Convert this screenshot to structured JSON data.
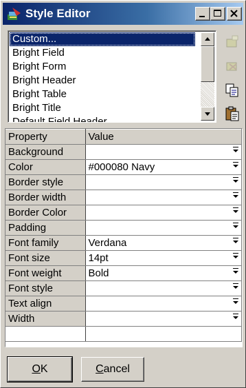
{
  "window": {
    "title": "Style Editor",
    "caption_buttons": [
      "minimize",
      "maximize",
      "close"
    ]
  },
  "style_list": {
    "items": [
      "Custom...",
      "Bright Field",
      "Bright Form",
      "Bright Header",
      "Bright Table",
      "Bright Title",
      "Default Field Header"
    ],
    "selected_index": 0
  },
  "side_tools": [
    {
      "name": "new-style-icon",
      "enabled": false
    },
    {
      "name": "delete-style-icon",
      "enabled": false
    },
    {
      "name": "copy-icon",
      "enabled": true
    },
    {
      "name": "paste-icon",
      "enabled": true
    }
  ],
  "grid": {
    "header_property": "Property",
    "header_value": "Value",
    "rows": [
      {
        "property": "Background",
        "value": ""
      },
      {
        "property": "Color",
        "value": "#000080  Navy"
      },
      {
        "property": "Border style",
        "value": ""
      },
      {
        "property": "Border width",
        "value": ""
      },
      {
        "property": "Border Color",
        "value": ""
      },
      {
        "property": "Padding",
        "value": ""
      },
      {
        "property": "Font family",
        "value": "Verdana"
      },
      {
        "property": "Font size",
        "value": "14pt"
      },
      {
        "property": "Font weight",
        "value": "Bold"
      },
      {
        "property": "Font style",
        "value": ""
      },
      {
        "property": "Text align",
        "value": ""
      },
      {
        "property": "Width",
        "value": ""
      }
    ]
  },
  "buttons": {
    "ok": {
      "mnemonic": "O",
      "rest": "K"
    },
    "cancel": {
      "mnemonic": "C",
      "rest": "ancel"
    }
  },
  "colors": {
    "title_bar": "#0a246a",
    "selection": "#0a246a",
    "face": "#d4d0c8"
  }
}
